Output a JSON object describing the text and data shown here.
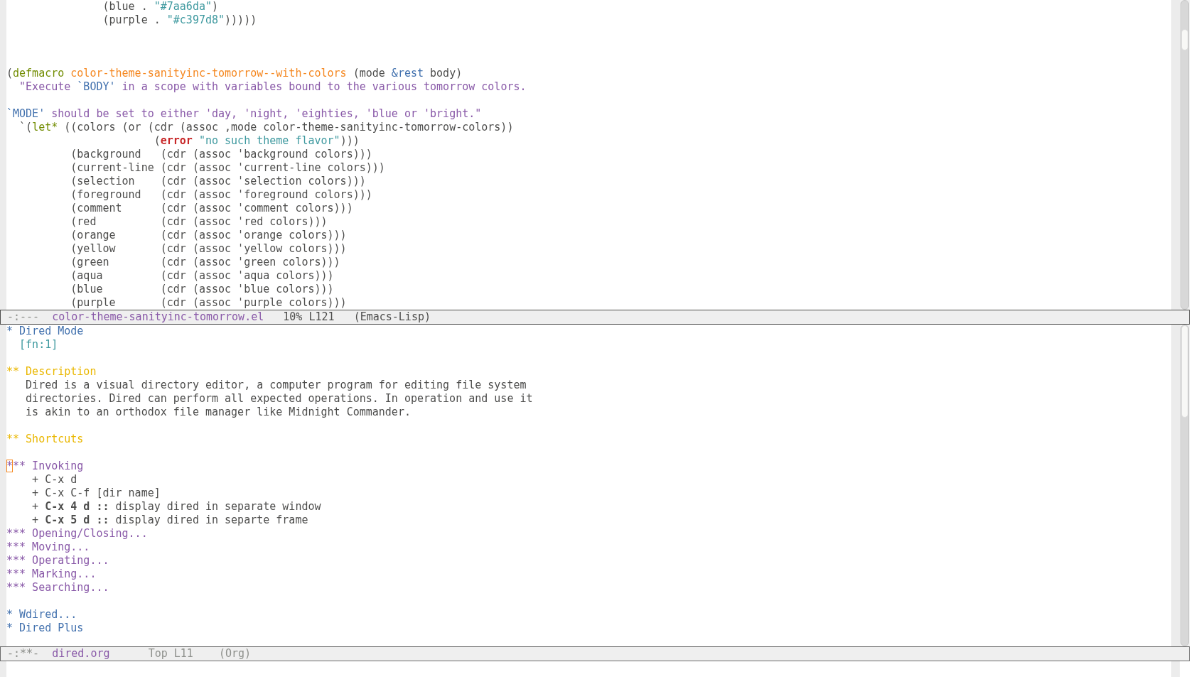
{
  "windows": [
    {
      "lines": [
        {
          "kind": "text",
          "segments": [
            {
              "text": "               (blue . ",
              "kind": "plain"
            },
            {
              "text": "\"#7aa6da\"",
              "kind": "string"
            },
            {
              "text": ")",
              "kind": "plain"
            }
          ]
        },
        {
          "kind": "text",
          "segments": [
            {
              "text": "               (purple . ",
              "kind": "plain"
            },
            {
              "text": "\"#c397d8\"",
              "kind": "string"
            },
            {
              "text": ")))))",
              "kind": "plain"
            }
          ]
        },
        {
          "kind": "blank"
        },
        {
          "kind": "blank"
        },
        {
          "kind": "blank"
        },
        {
          "kind": "text",
          "segments": [
            {
              "text": "(",
              "kind": "plain"
            },
            {
              "text": "defmacro",
              "kind": "keyword"
            },
            {
              "text": " color-theme-sanityinc-tomorrow--with-colors",
              "kind": "function"
            },
            {
              "text": " (mode ",
              "kind": "plain"
            },
            {
              "text": "&rest",
              "kind": "variable"
            },
            {
              "text": " body)",
              "kind": "plain"
            }
          ]
        },
        {
          "kind": "text",
          "segments": [
            {
              "text": "  \"Execute ",
              "kind": "doc"
            },
            {
              "text": "`BODY'",
              "kind": "variable"
            },
            {
              "text": " in a scope with variables bound to the various tomorrow colors.",
              "kind": "doc"
            }
          ]
        },
        {
          "kind": "blank"
        },
        {
          "kind": "text",
          "segments": [
            {
              "text": "`MODE'",
              "kind": "variable"
            },
            {
              "text": " should be set to either 'day, 'night, 'eighties, 'blue or 'bright.\"",
              "kind": "doc"
            }
          ]
        },
        {
          "kind": "text",
          "segments": [
            {
              "text": "  `(",
              "kind": "plain"
            },
            {
              "text": "let*",
              "kind": "keyword"
            },
            {
              "text": " ((colors (or (cdr (assoc ,mode color-theme-sanityinc-tomorrow-colors))",
              "kind": "plain"
            }
          ]
        },
        {
          "kind": "text",
          "segments": [
            {
              "text": "                       (",
              "kind": "plain"
            },
            {
              "text": "error",
              "kind": "error"
            },
            {
              "text": " \"no such theme flavor\"",
              "kind": "string"
            },
            {
              "text": ")))",
              "kind": "plain"
            }
          ]
        },
        {
          "kind": "text",
          "segments": [
            {
              "text": "          (background   (cdr (assoc 'background colors)))",
              "kind": "plain"
            }
          ]
        },
        {
          "kind": "text",
          "segments": [
            {
              "text": "          (current-line (cdr (assoc 'current-line colors)))",
              "kind": "plain"
            }
          ]
        },
        {
          "kind": "text",
          "segments": [
            {
              "text": "          (selection    (cdr (assoc 'selection colors)))",
              "kind": "plain"
            }
          ]
        },
        {
          "kind": "text",
          "segments": [
            {
              "text": "          (foreground   (cdr (assoc 'foreground colors)))",
              "kind": "plain"
            }
          ]
        },
        {
          "kind": "text",
          "segments": [
            {
              "text": "          (comment      (cdr (assoc 'comment colors)))",
              "kind": "plain"
            }
          ]
        },
        {
          "kind": "text",
          "segments": [
            {
              "text": "          (red          (cdr (assoc 'red colors)))",
              "kind": "plain"
            }
          ]
        },
        {
          "kind": "text",
          "segments": [
            {
              "text": "          (orange       (cdr (assoc 'orange colors)))",
              "kind": "plain"
            }
          ]
        },
        {
          "kind": "text",
          "segments": [
            {
              "text": "          (yellow       (cdr (assoc 'yellow colors)))",
              "kind": "plain"
            }
          ]
        },
        {
          "kind": "text",
          "segments": [
            {
              "text": "          (green        (cdr (assoc 'green colors)))",
              "kind": "plain"
            }
          ]
        },
        {
          "kind": "text",
          "segments": [
            {
              "text": "          (aqua         (cdr (assoc 'aqua colors)))",
              "kind": "plain"
            }
          ]
        },
        {
          "kind": "text",
          "segments": [
            {
              "text": "          (blue         (cdr (assoc 'blue colors)))",
              "kind": "plain"
            }
          ]
        },
        {
          "kind": "text",
          "segments": [
            {
              "text": "          (purple       (cdr (assoc 'purple colors)))",
              "kind": "plain"
            }
          ]
        }
      ],
      "mode_line": {
        "active": true,
        "status": "-:---",
        "buffer": "color-theme-sanityinc-tomorrow.el",
        "position": "10% L121",
        "mode": "(Emacs-Lisp)"
      }
    },
    {
      "lines": [
        {
          "kind": "text",
          "segments": [
            {
              "text": "* Dired Mode",
              "kind": "heading1"
            }
          ]
        },
        {
          "kind": "text",
          "segments": [
            {
              "text": "  [fn:1]",
              "kind": "footnote"
            }
          ]
        },
        {
          "kind": "blank"
        },
        {
          "kind": "text",
          "segments": [
            {
              "text": "** Description",
              "kind": "heading2"
            }
          ]
        },
        {
          "kind": "text",
          "segments": [
            {
              "text": "   Dired is a visual directory editor, a computer program for editing file system",
              "kind": "plain"
            }
          ]
        },
        {
          "kind": "text",
          "segments": [
            {
              "text": "   directories. Dired can perform all expected operations. In operation and use it",
              "kind": "plain"
            }
          ]
        },
        {
          "kind": "text",
          "segments": [
            {
              "text": "   is akin to an orthodox file manager like Midnight Commander.",
              "kind": "plain"
            }
          ]
        },
        {
          "kind": "blank"
        },
        {
          "kind": "text",
          "segments": [
            {
              "text": "** Shortcuts",
              "kind": "heading2"
            }
          ]
        },
        {
          "kind": "blank"
        },
        {
          "kind": "text",
          "segments": [
            {
              "text": "*",
              "kind": "heading3",
              "cursor": true
            },
            {
              "text": "** Invoking",
              "kind": "heading3"
            }
          ]
        },
        {
          "kind": "text",
          "segments": [
            {
              "text": "    + C-x d",
              "kind": "plain"
            }
          ]
        },
        {
          "kind": "text",
          "segments": [
            {
              "text": "    + C-x C-f [dir name]",
              "kind": "plain"
            }
          ]
        },
        {
          "kind": "text",
          "segments": [
            {
              "text": "    + ",
              "kind": "plain"
            },
            {
              "text": "C-x 4 d ::",
              "kind": "bold"
            },
            {
              "text": " display dired in separate window",
              "kind": "plain"
            }
          ]
        },
        {
          "kind": "text",
          "segments": [
            {
              "text": "    + ",
              "kind": "plain"
            },
            {
              "text": "C-x 5 d ::",
              "kind": "bold"
            },
            {
              "text": " display dired in separte frame",
              "kind": "plain"
            }
          ]
        },
        {
          "kind": "text",
          "segments": [
            {
              "text": "*** Opening/Closing...",
              "kind": "heading3"
            }
          ]
        },
        {
          "kind": "text",
          "segments": [
            {
              "text": "*** Moving...",
              "kind": "heading3"
            }
          ]
        },
        {
          "kind": "text",
          "segments": [
            {
              "text": "*** Operating...",
              "kind": "heading3"
            }
          ]
        },
        {
          "kind": "text",
          "segments": [
            {
              "text": "*** Marking...",
              "kind": "heading3"
            }
          ]
        },
        {
          "kind": "text",
          "segments": [
            {
              "text": "*** Searching...",
              "kind": "heading3"
            }
          ]
        },
        {
          "kind": "blank"
        },
        {
          "kind": "text",
          "segments": [
            {
              "text": "* Wdired...",
              "kind": "heading1"
            }
          ]
        },
        {
          "kind": "text",
          "segments": [
            {
              "text": "* Dired Plus",
              "kind": "heading1"
            }
          ]
        }
      ],
      "mode_line": {
        "active": false,
        "status": "-:**-",
        "buffer": "dired.org",
        "position": "Top L11",
        "mode": "(Org)"
      }
    }
  ]
}
